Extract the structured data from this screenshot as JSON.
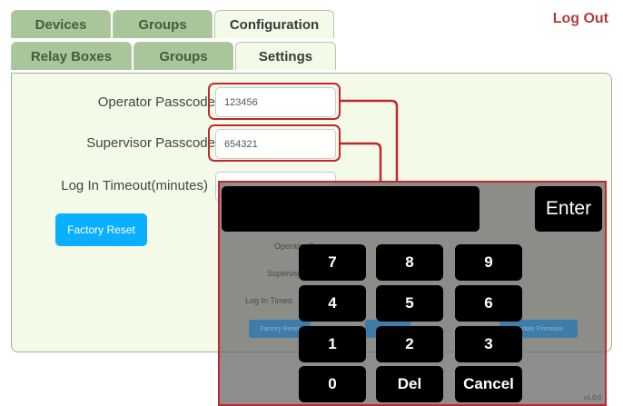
{
  "nav": {
    "tabs_top": [
      "Devices",
      "Groups",
      "Configuration"
    ],
    "tabs_sub": [
      "Relay Boxes",
      "Groups",
      "Settings"
    ],
    "logout_label": "Log Out"
  },
  "settings": {
    "operator_label": "Operator Passcode",
    "operator_value": "123456",
    "supervisor_label": "Supervisor Passcode",
    "supervisor_value": "654321",
    "timeout_label": "Log In Timeout(minutes)",
    "factory_reset_label": "Factory Reset"
  },
  "keypad": {
    "enter_label": "Enter",
    "keys": [
      "7",
      "8",
      "9",
      "4",
      "5",
      "6",
      "1",
      "2",
      "3",
      "0",
      "Del",
      "Cancel"
    ],
    "version": "v1.0.0"
  },
  "background_ghost": {
    "operator": "Operator P",
    "supervisor": "Supervisor",
    "timeout": "Log In Timeo",
    "factory_reset": "Factory Reset",
    "firmware": "Update Firmware"
  },
  "colors": {
    "accent_red": "#c1272d",
    "tab_active": "#f3fbe8",
    "tab_inactive": "#a9c59a",
    "button_blue": "#0aafff"
  }
}
